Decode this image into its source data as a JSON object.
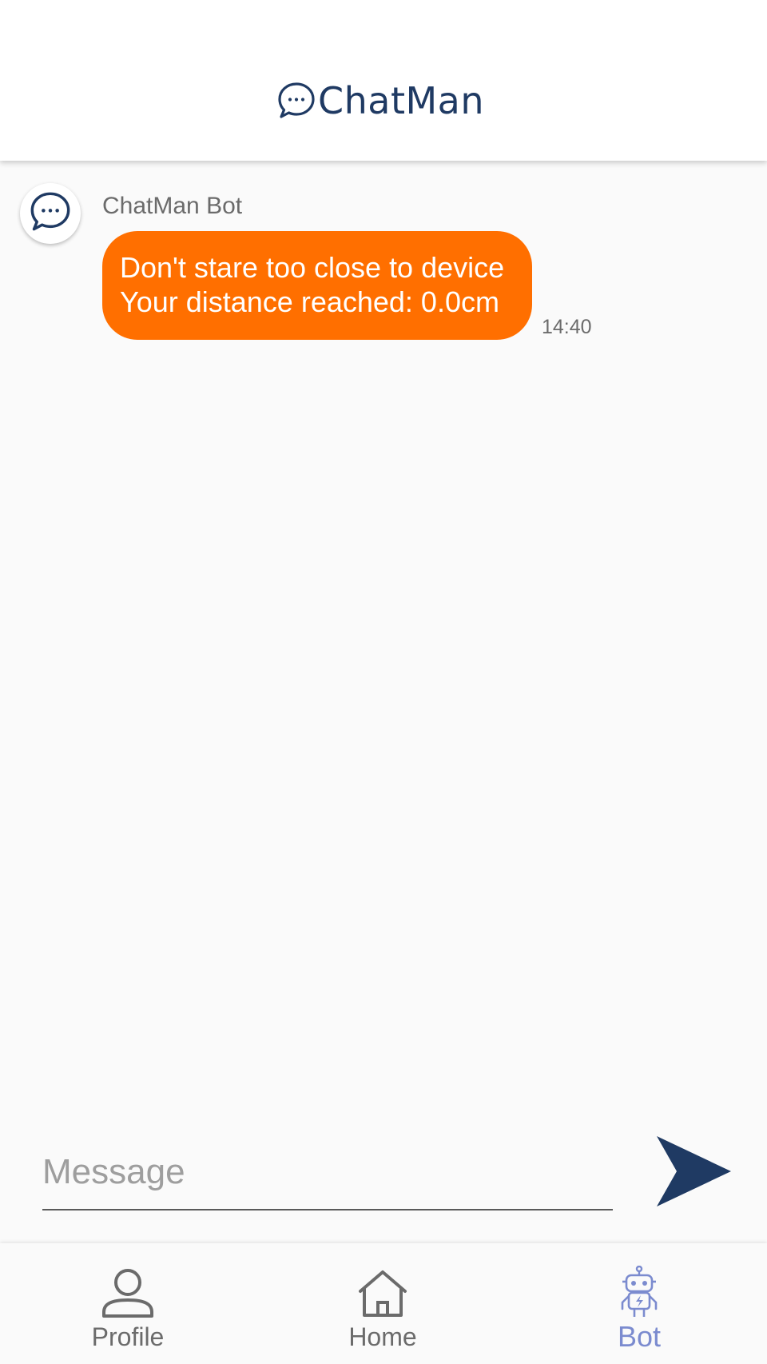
{
  "header": {
    "app_title": "ChatMan",
    "brand_color": "#1f3a63"
  },
  "chat": {
    "messages": [
      {
        "sender": "ChatMan Bot",
        "lines": [
          "Don't stare too close to device",
          "Your distance reached: 0.0cm"
        ],
        "time": "14:40",
        "bubble_color": "#ff6f00"
      }
    ]
  },
  "composer": {
    "placeholder": "Message",
    "value": ""
  },
  "bottom_nav": {
    "items": [
      {
        "label": "Profile",
        "icon": "person-icon"
      },
      {
        "label": "Home",
        "icon": "home-icon"
      },
      {
        "label": "Bot",
        "icon": "robot-icon",
        "active": true
      }
    ],
    "active_color": "#7b8bcf"
  }
}
